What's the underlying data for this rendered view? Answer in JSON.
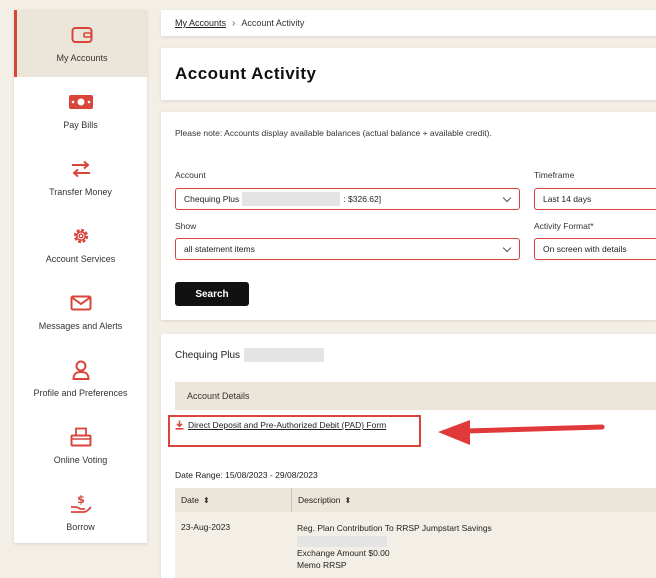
{
  "sidebar": {
    "items": [
      {
        "label": "My Accounts",
        "icon": "wallet-icon",
        "active": true
      },
      {
        "label": "Pay Bills",
        "icon": "bill-icon"
      },
      {
        "label": "Transfer Money",
        "icon": "transfer-arrows-icon"
      },
      {
        "label": "Account Services",
        "icon": "gear-icon"
      },
      {
        "label": "Messages and Alerts",
        "icon": "envelope-icon"
      },
      {
        "label": "Profile and Preferences",
        "icon": "person-icon"
      },
      {
        "label": "Online Voting",
        "icon": "ballot-box-icon"
      },
      {
        "label": "Borrow",
        "icon": "hand-dollar-icon"
      }
    ]
  },
  "breadcrumb": {
    "root": "My Accounts",
    "current": "Account Activity"
  },
  "page": {
    "title": "Account Activity"
  },
  "form": {
    "note": "Please note: Accounts display available balances (actual balance + available credit).",
    "account_label": "Account",
    "account_value_prefix": "Chequing Plus",
    "account_value_suffix": ": $326.62]",
    "timeframe_label": "Timeframe",
    "timeframe_value": "Last 14 days",
    "show_label": "Show",
    "show_value": "all statement items",
    "format_label": "Activity Format*",
    "format_value": "On screen with details",
    "search_label": "Search"
  },
  "details": {
    "account_name": "Chequing Plus",
    "section_title": "Account Details",
    "pad_link": "Direct Deposit and Pre-Authorized Debit (PAD) Form",
    "date_range": "Date Range: 15/08/2023 - 29/08/2023",
    "columns": [
      "Date",
      "Description"
    ],
    "rows": [
      {
        "date": "23-Aug-2023",
        "description": "Reg. Plan Contribution To RRSP Jumpstart Savings",
        "exchange": "Exchange Amount $0.00",
        "memo": "Memo RRSP"
      }
    ]
  },
  "colors": {
    "accent": "#d9453a",
    "beige": "#ece6da",
    "background": "#f3efe6"
  }
}
